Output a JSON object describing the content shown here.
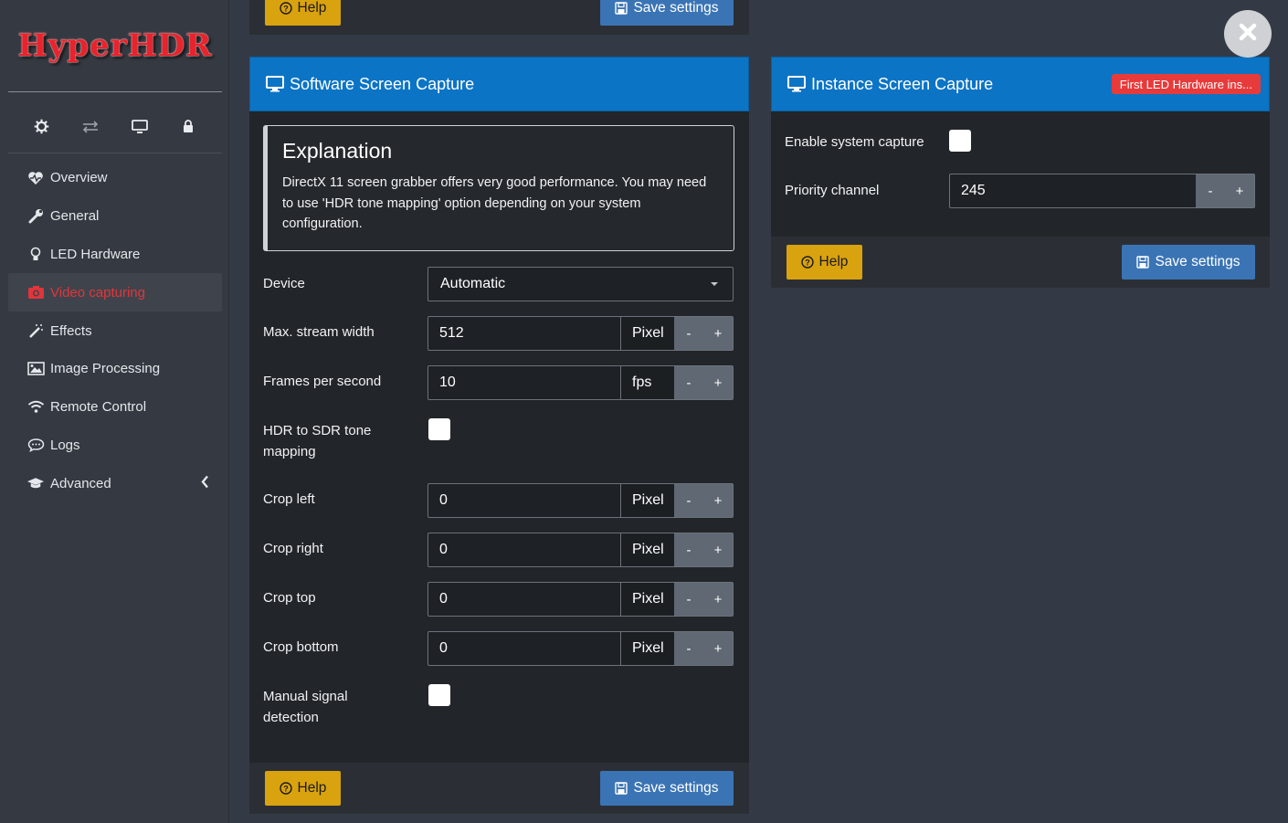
{
  "app": {
    "logo_text": "HyperHDR"
  },
  "sidebar": {
    "icons": [
      "gear-icon",
      "transfer-icon",
      "monitor-icon",
      "lock-icon"
    ],
    "items": [
      {
        "label": "Overview",
        "icon": "heart-pulse-icon"
      },
      {
        "label": "General",
        "icon": "wrench-icon"
      },
      {
        "label": "LED Hardware",
        "icon": "bulb-icon"
      },
      {
        "label": "Video capturing",
        "icon": "camera-icon",
        "active": true
      },
      {
        "label": "Effects",
        "icon": "magic-wand-icon"
      },
      {
        "label": "Image Processing",
        "icon": "image-icon"
      },
      {
        "label": "Remote Control",
        "icon": "wifi-icon"
      },
      {
        "label": "Logs",
        "icon": "comment-icon"
      },
      {
        "label": "Advanced",
        "icon": "graduation-cap-icon"
      }
    ]
  },
  "top_footer": {
    "help_label": "Help",
    "save_label": "Save settings"
  },
  "software_panel": {
    "title": "Software Screen Capture",
    "explanation": {
      "heading": "Explanation",
      "text": "DirectX 11 screen grabber offers very good performance. You may need to use 'HDR tone mapping' option depending on your system configuration."
    },
    "device": {
      "label": "Device",
      "value": "Automatic"
    },
    "max_width": {
      "label": "Max. stream width",
      "value": "512",
      "unit": "Pixel"
    },
    "fps": {
      "label": "Frames per second",
      "value": "10",
      "unit": "fps"
    },
    "hdr": {
      "label": "HDR to SDR tone mapping",
      "checked": false
    },
    "crop_left": {
      "label": "Crop left",
      "value": "0",
      "unit": "Pixel"
    },
    "crop_right": {
      "label": "Crop right",
      "value": "0",
      "unit": "Pixel"
    },
    "crop_top": {
      "label": "Crop top",
      "value": "0",
      "unit": "Pixel"
    },
    "crop_bottom": {
      "label": "Crop bottom",
      "value": "0",
      "unit": "Pixel"
    },
    "manual_signal": {
      "label": "Manual signal detection",
      "checked": false
    },
    "stepper": {
      "minus": "-",
      "plus": "+"
    },
    "help_label": "Help",
    "save_label": "Save settings"
  },
  "instance_panel": {
    "title": "Instance Screen Capture",
    "badge": "First LED Hardware ins...",
    "enable": {
      "label": "Enable system capture",
      "checked": false
    },
    "priority": {
      "label": "Priority channel",
      "value": "245"
    },
    "stepper": {
      "minus": "-",
      "plus": "+"
    },
    "help_label": "Help",
    "save_label": "Save settings"
  },
  "colors": {
    "header_blue": "#0c74c5",
    "help_yellow": "#d9a20f",
    "save_blue": "#3a74b5",
    "active_red": "#e3343b",
    "badge_red": "#e73b3b"
  }
}
